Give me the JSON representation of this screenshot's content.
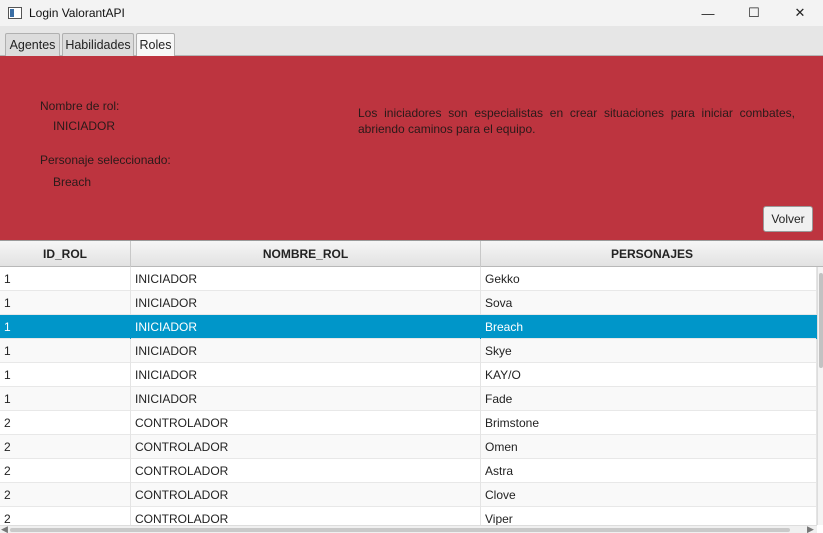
{
  "window": {
    "title": "Login ValorantAPI",
    "minimize_glyph": "—",
    "maximize_glyph": "☐",
    "close_glyph": "✕"
  },
  "tabs": [
    {
      "label": "Agentes"
    },
    {
      "label": "Habilidades"
    },
    {
      "label": "Roles",
      "active": true
    }
  ],
  "role_panel": {
    "role_name_label": "Nombre de rol:",
    "role_name_value": "INICIADOR",
    "character_label": "Personaje seleccionado:",
    "character_value": "Breach",
    "description": "Los iniciadores son especialistas en crear situaciones para iniciar combates, abriendo caminos para el equipo.",
    "back_button": "Volver",
    "background_color": "#bd343f"
  },
  "table": {
    "columns": [
      "ID_ROL",
      "NOMBRE_ROL",
      "PERSONAJES"
    ],
    "selected_row": 2,
    "selection_color": "#0096c9",
    "rows": [
      [
        "1",
        "INICIADOR",
        "Gekko"
      ],
      [
        "1",
        "INICIADOR",
        "Sova"
      ],
      [
        "1",
        "INICIADOR",
        "Breach"
      ],
      [
        "1",
        "INICIADOR",
        "Skye"
      ],
      [
        "1",
        "INICIADOR",
        "KAY/O"
      ],
      [
        "1",
        "INICIADOR",
        "Fade"
      ],
      [
        "2",
        "CONTROLADOR",
        "Brimstone"
      ],
      [
        "2",
        "CONTROLADOR",
        "Omen"
      ],
      [
        "2",
        "CONTROLADOR",
        "Astra"
      ],
      [
        "2",
        "CONTROLADOR",
        "Clove"
      ],
      [
        "2",
        "CONTROLADOR",
        "Viper"
      ]
    ]
  }
}
